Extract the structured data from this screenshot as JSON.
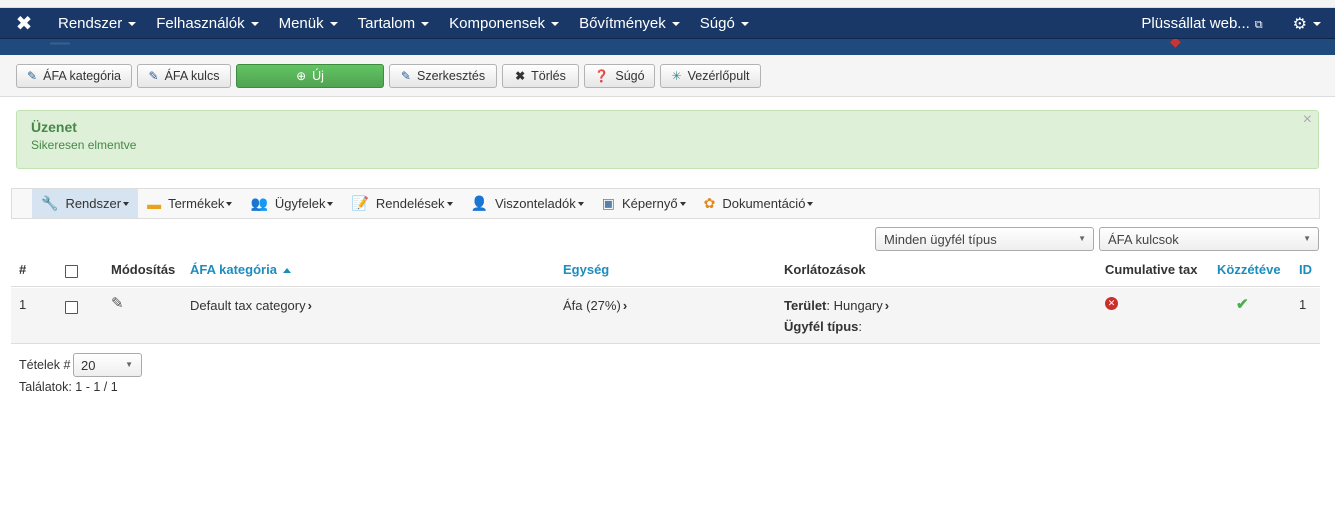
{
  "navbar": {
    "logo_icon": "joomla-logo-icon",
    "menu": [
      {
        "label": "Rendszer"
      },
      {
        "label": "Felhasználók"
      },
      {
        "label": "Menük"
      },
      {
        "label": "Tartalom"
      },
      {
        "label": "Komponensek"
      },
      {
        "label": "Bővítmények"
      },
      {
        "label": "Súgó"
      }
    ],
    "site_link": "Plüssállat web...",
    "colors": {
      "bar": "#1a3867"
    }
  },
  "toolbar": {
    "buttons": [
      {
        "label": "ÁFA kategória",
        "icon": "edit-icon"
      },
      {
        "label": "ÁFA kulcs",
        "icon": "edit-icon"
      },
      {
        "label": "Új",
        "icon": "plus-circle-icon"
      },
      {
        "label": "Szerkesztés",
        "icon": "edit-icon"
      },
      {
        "label": "Törlés",
        "icon": "close-icon"
      },
      {
        "label": "Súgó",
        "icon": "help-icon"
      },
      {
        "label": "Vezérlőpult",
        "icon": "dashboard-icon"
      }
    ]
  },
  "alert": {
    "heading": "Üzenet",
    "message": "Sikeresen elmentve",
    "close": "×"
  },
  "submenu": {
    "items": [
      {
        "label": "Rendszer",
        "icon": "wrench-icon",
        "active": true
      },
      {
        "label": "Termékek",
        "icon": "box-icon"
      },
      {
        "label": "Ügyfelek",
        "icon": "users-icon"
      },
      {
        "label": "Rendelések",
        "icon": "orders-icon"
      },
      {
        "label": "Viszonteladók",
        "icon": "reseller-icon"
      },
      {
        "label": "Képernyő",
        "icon": "screen-icon"
      },
      {
        "label": "Dokumentáció",
        "icon": "docs-icon"
      }
    ]
  },
  "filters": {
    "customer_type": "Minden ügyfél típus",
    "tax_rate": "ÁFA kulcsok"
  },
  "table": {
    "headers": {
      "num": "#",
      "modify": "Módosítás",
      "category": "ÁFA kategória",
      "unit": "Egység",
      "restrictions": "Korlátozások",
      "cumulative": "Cumulative tax",
      "published": "Közzétéve",
      "id": "ID"
    },
    "rows": [
      {
        "num": "1",
        "category": "Default tax category",
        "unit": "Áfa (27%)",
        "territory_label": "Terület",
        "territory_value": "Hungary",
        "customer_type_label": "Ügyfél típus",
        "customer_type_value": "",
        "id": "1"
      }
    ]
  },
  "footer": {
    "items_label": "Tételek #",
    "items_value": "20",
    "results": "Találatok: 1 - 1 / 1"
  }
}
